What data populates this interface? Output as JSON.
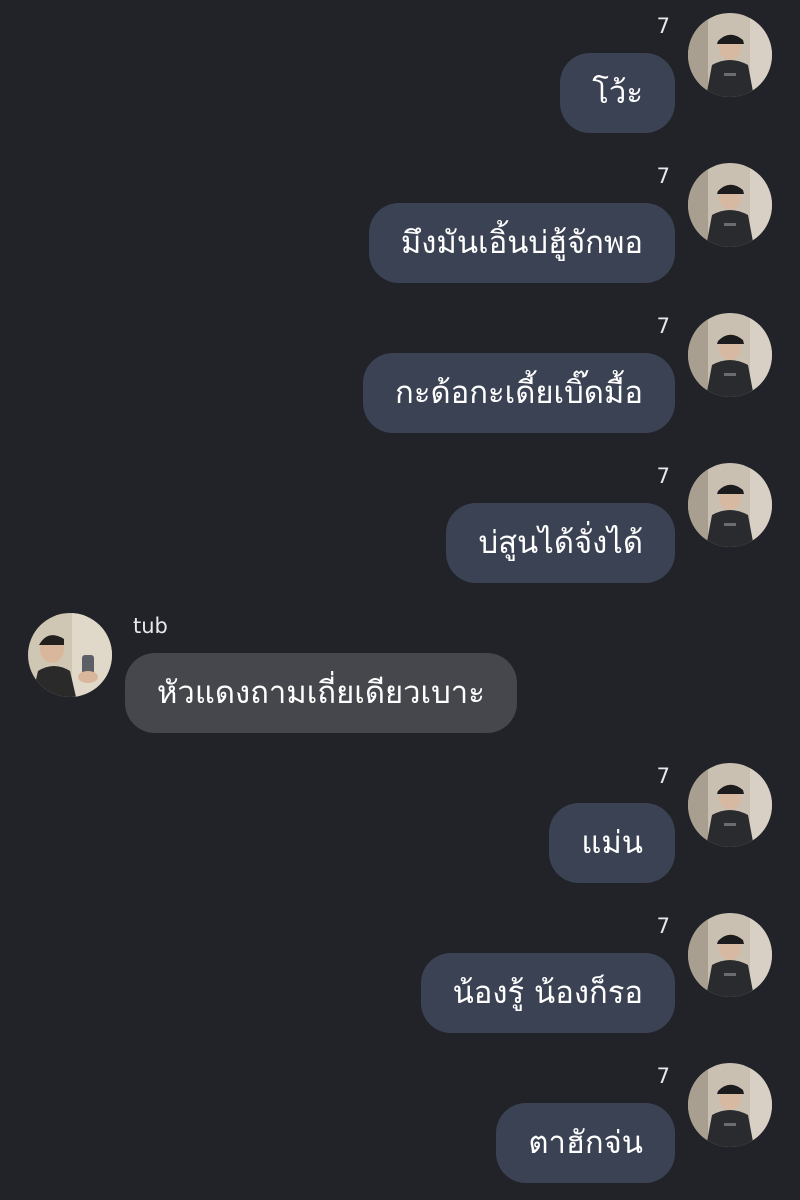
{
  "chat": {
    "messages": [
      {
        "side": "out",
        "sender": "7",
        "text": "โว้ะ"
      },
      {
        "side": "out",
        "sender": "7",
        "text": "มึงมันเอิ้นบ่ฮู้จักพอ"
      },
      {
        "side": "out",
        "sender": "7",
        "text": "กะด้อกะเดี้ยเบิ๊ดมื้อ"
      },
      {
        "side": "out",
        "sender": "7",
        "text": "บ่สูนได้จั่งได้"
      },
      {
        "side": "in",
        "sender": "tub",
        "text": "หัวแดงถามเถี่ยเดียวเบาะ"
      },
      {
        "side": "out",
        "sender": "7",
        "text": "แม่น"
      },
      {
        "side": "out",
        "sender": "7",
        "text": "น้องรู้ น้องก็รอ"
      },
      {
        "side": "out",
        "sender": "7",
        "text": "ตาฮักจ่น"
      }
    ]
  },
  "colors": {
    "background": "#222328",
    "outgoing_bubble": "#3b4253",
    "incoming_bubble": "#46474c"
  }
}
